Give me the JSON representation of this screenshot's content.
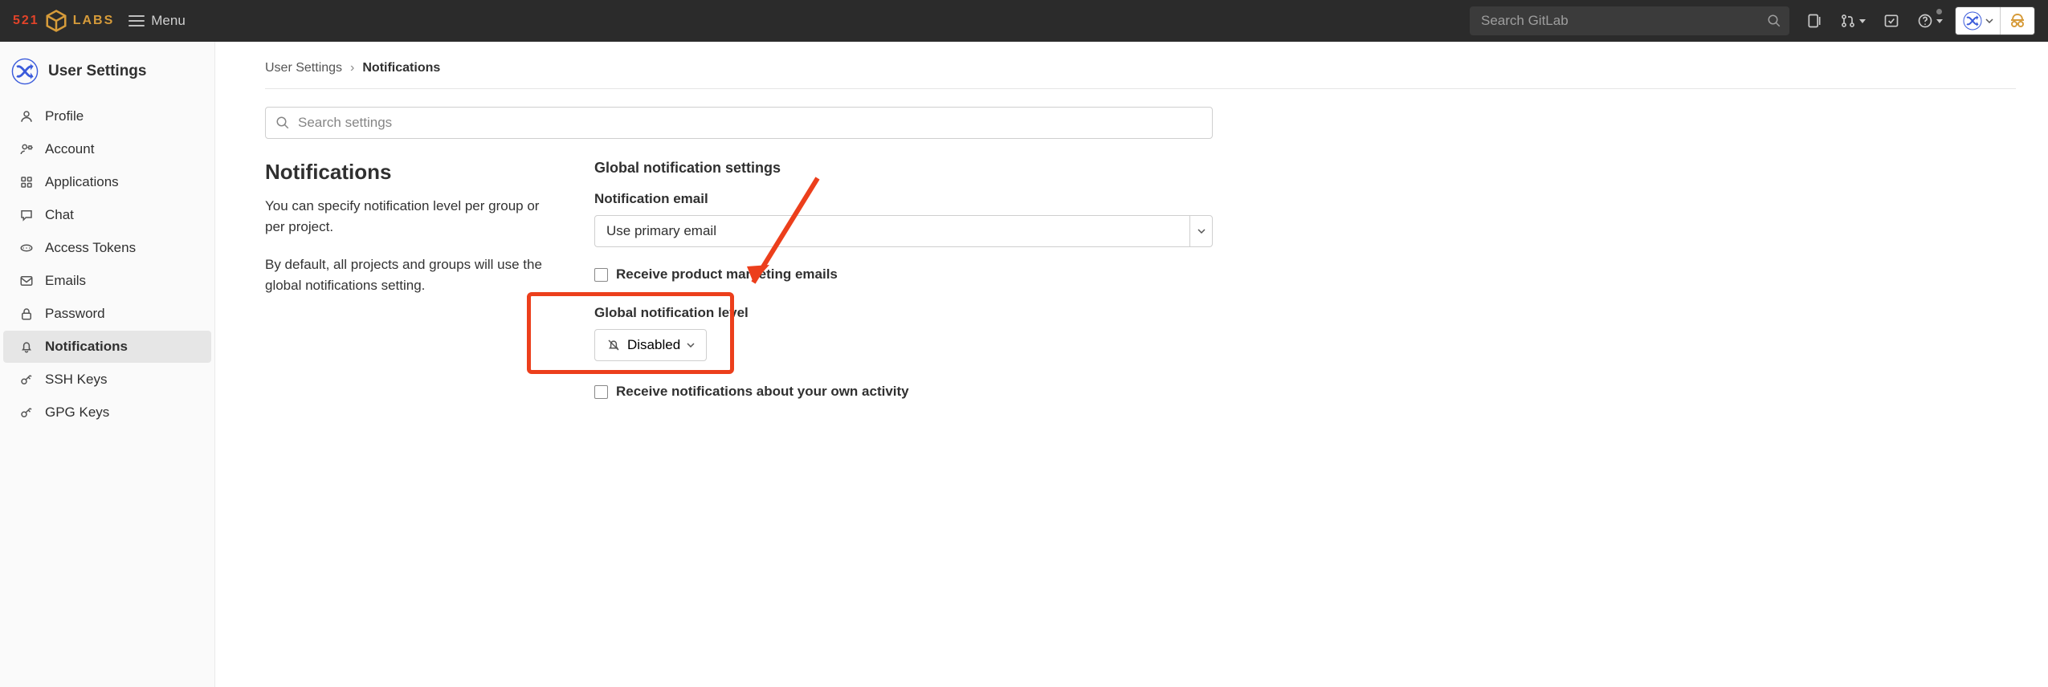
{
  "topnav": {
    "logo_prefix": "521",
    "logo_suffix": "LABS",
    "menu_label": "Menu",
    "search_placeholder": "Search GitLab"
  },
  "sidebar": {
    "header": "User Settings",
    "items": [
      {
        "icon": "profile",
        "label": "Profile"
      },
      {
        "icon": "account",
        "label": "Account"
      },
      {
        "icon": "applications",
        "label": "Applications"
      },
      {
        "icon": "chat",
        "label": "Chat"
      },
      {
        "icon": "tokens",
        "label": "Access Tokens"
      },
      {
        "icon": "emails",
        "label": "Emails"
      },
      {
        "icon": "password",
        "label": "Password"
      },
      {
        "icon": "notifications",
        "label": "Notifications"
      },
      {
        "icon": "ssh",
        "label": "SSH Keys"
      },
      {
        "icon": "gpg",
        "label": "GPG Keys"
      }
    ]
  },
  "breadcrumb": {
    "root": "User Settings",
    "current": "Notifications"
  },
  "search_settings_placeholder": "Search settings",
  "left_col": {
    "title": "Notifications",
    "desc1": "You can specify notification level per group or per project.",
    "desc2": "By default, all projects and groups will use the global notifications setting."
  },
  "right_col": {
    "section_title": "Global notification settings",
    "email_label": "Notification email",
    "email_value": "Use primary email",
    "marketing_label": "Receive product marketing emails",
    "level_label": "Global notification level",
    "level_value": "Disabled",
    "own_activity_label": "Receive notifications about your own activity"
  }
}
